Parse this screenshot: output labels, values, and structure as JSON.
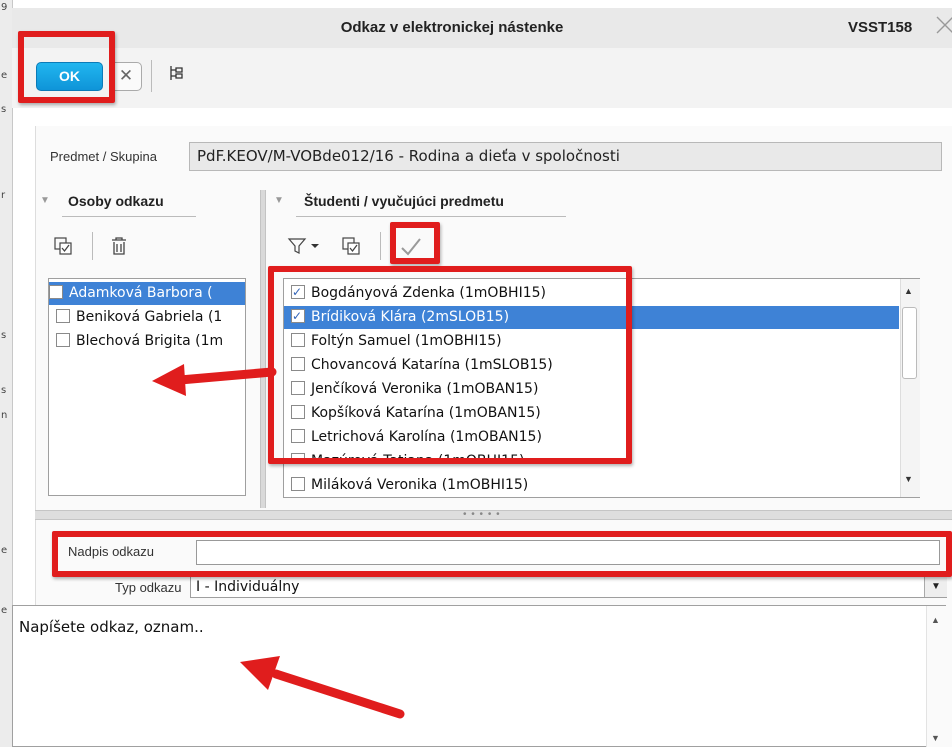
{
  "window": {
    "title": "Odkaz v elektronickej nástenke",
    "code": "VSST158"
  },
  "toolbar": {
    "ok_label": "OK",
    "cancel_label": "✕"
  },
  "form": {
    "subject_label": "Predmet / Skupina",
    "subject_value": "PdF.KEOV/M-VOBde012/16 - Rodina a dieťa v spoločnosti"
  },
  "left_panel": {
    "title": "Osoby odkazu",
    "items": [
      {
        "name": "Adamková Barbora (",
        "checked": false,
        "selected": true
      },
      {
        "name": "Beniková Gabriela (1",
        "checked": false,
        "selected": false
      },
      {
        "name": "Blechová Brigita (1m",
        "checked": false,
        "selected": false
      }
    ]
  },
  "right_panel": {
    "title": "Študenti / vyučujúci predmetu",
    "items": [
      {
        "name": "Bogdányová Zdenka (1mOBHI15)",
        "checked": true,
        "selected": false
      },
      {
        "name": "Brídiková Klára (2mSLOB15)",
        "checked": true,
        "selected": true
      },
      {
        "name": "Foltýn Samuel (1mOBHI15)",
        "checked": false,
        "selected": false
      },
      {
        "name": "Chovancová Katarína (1mSLOB15)",
        "checked": false,
        "selected": false
      },
      {
        "name": "Jenčíková Veronika (1mOBAN15)",
        "checked": false,
        "selected": false
      },
      {
        "name": "Kopšíková Katarína (1mOBAN15)",
        "checked": false,
        "selected": false
      },
      {
        "name": "Letrichová Karolína (1mOBAN15)",
        "checked": false,
        "selected": false
      },
      {
        "name": "Mazúrová Tatiana (1mOBHI15)",
        "checked": false,
        "selected": false
      },
      {
        "name": "Miláková Veronika (1mOBHI15)",
        "checked": false,
        "selected": false
      }
    ]
  },
  "message": {
    "heading_label": "Nadpis odkazu",
    "heading_value": "",
    "type_label": "Typ odkazu",
    "type_value": "I - Individuálny",
    "body_text": "Napíšete odkaz, oznam.."
  },
  "colors": {
    "accent": "#1ba6e6",
    "selection": "#3e82d6",
    "annotation": "#e01d1d"
  },
  "icons": [
    "close-icon",
    "tree-icon",
    "add-checkbox-icon",
    "trash-icon",
    "filter-icon",
    "checkmark-icon",
    "scroll-up-icon",
    "scroll-down-icon",
    "dropdown-arrow-icon"
  ]
}
